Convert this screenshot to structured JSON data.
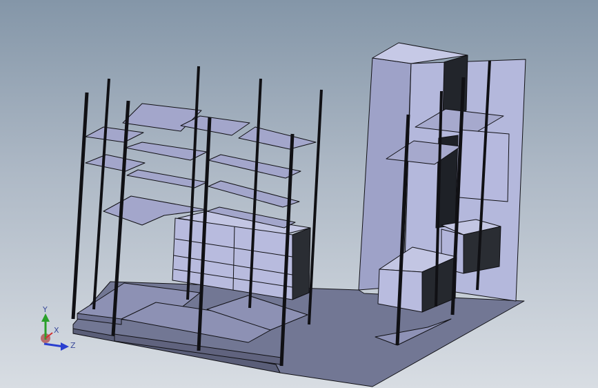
{
  "viewport": {
    "name": "cad-3d-graphics-area",
    "background": "gradient-blue-gray"
  },
  "model": {
    "description": "shelving-units-assembly"
  },
  "triad": {
    "x_label": "X",
    "y_label": "Y",
    "z_label": "Z",
    "colors": {
      "x": "#d03030",
      "y": "#2aa02a",
      "z": "#2a3fd0"
    }
  },
  "palette": {
    "face_light": "#b9bcdc",
    "face_mid": "#9c9fc4",
    "face_dark": "#2a2d33",
    "floor": "#727794",
    "edge": "#101014"
  }
}
